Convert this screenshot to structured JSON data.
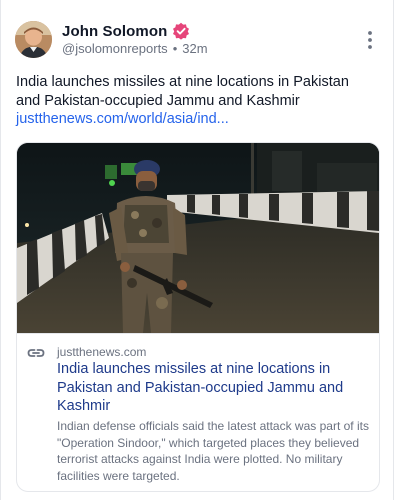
{
  "post": {
    "author": {
      "name": "John Solomon",
      "handle": "@jsolomonreports",
      "time": "32m",
      "verified": true,
      "verified_color": "#e6457a"
    },
    "text": "India launches missiles at nine locations in Pakistan and Pakistan-occupied Jammu and Kashmir",
    "link_text": "justthenews.com/world/asia/ind...",
    "link_color": "#2563eb",
    "menu_icon": "more-vertical-icon",
    "card": {
      "domain": "justthenews.com",
      "title": "India launches missiles at nine locations in Pakistan and Pakistan-occupied Jammu and Kashmir",
      "description": "Indian defense officials said the latest attack was part of its \"Operation Sindoor,\" which targeted places they believed terrorist attacks against India were plotted. No military facilities were targeted.",
      "title_color": "#1e3a8a",
      "image_icon": "soldier-photo",
      "link_icon": "link-icon"
    }
  }
}
